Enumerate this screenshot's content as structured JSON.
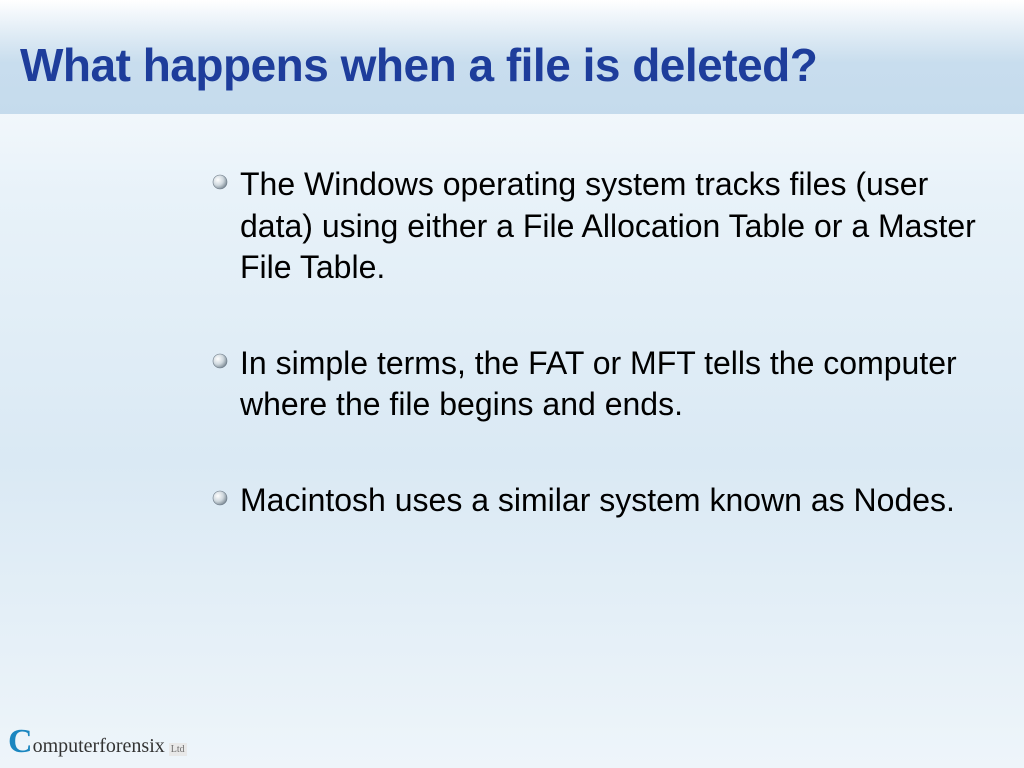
{
  "slide": {
    "title": "What happens when a file is deleted?",
    "bullets": [
      "The Windows operating system tracks files (user data) using either a File Allocation Table or a Master File Table.",
      "In simple terms, the FAT or MFT tells the computer where the file begins and ends.",
      "Macintosh uses a similar system known as Nodes."
    ]
  },
  "logo": {
    "initial": "C",
    "rest": "omputerforensix",
    "suffix": "Ltd"
  },
  "colors": {
    "title": "#1e3d9b",
    "logo_accent": "#1a86c0"
  }
}
